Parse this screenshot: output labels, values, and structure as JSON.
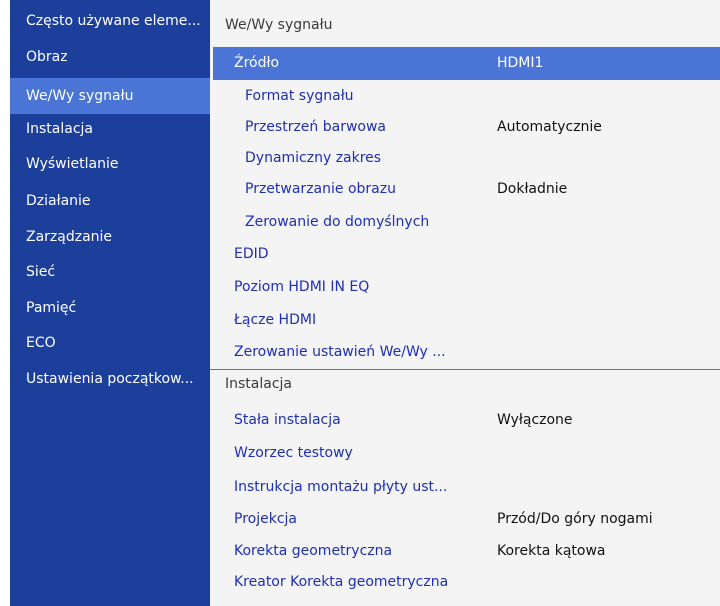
{
  "sidebar": {
    "items": [
      {
        "label": "Często używane eleme...",
        "active": false
      },
      {
        "label": "Obraz",
        "active": false
      },
      {
        "label": "We/Wy sygnału",
        "active": true
      },
      {
        "label": "Instalacja",
        "active": false
      },
      {
        "label": "Wyświetlanie",
        "active": false
      },
      {
        "label": "Działanie",
        "active": false
      },
      {
        "label": "Zarządzanie",
        "active": false
      },
      {
        "label": "Sieć",
        "active": false
      },
      {
        "label": "Pamięć",
        "active": false
      },
      {
        "label": "ECO",
        "active": false
      },
      {
        "label": "Ustawienia początkow...",
        "active": false
      }
    ]
  },
  "main": {
    "groups": [
      {
        "title": "We/Wy sygnału",
        "items": [
          {
            "label": "Źródło",
            "value": "HDMI1",
            "selected": true
          },
          {
            "label": "Format sygnału",
            "value": ""
          },
          {
            "label": "Przestrzeń barwowa",
            "value": "Automatycznie"
          },
          {
            "label": "Dynamiczny zakres",
            "value": ""
          },
          {
            "label": "Przetwarzanie obrazu",
            "value": "Dokładnie"
          },
          {
            "label": "Zerowanie do domyślnych",
            "value": ""
          },
          {
            "label": "EDID",
            "value": ""
          },
          {
            "label": "Poziom HDMI IN EQ",
            "value": ""
          },
          {
            "label": "Łącze HDMI",
            "value": ""
          },
          {
            "label": "Zerowanie ustawień We/Wy ...",
            "value": ""
          }
        ]
      },
      {
        "title": "Instalacja",
        "items": [
          {
            "label": "Stała instalacja",
            "value": "Wyłączone"
          },
          {
            "label": "Wzorzec testowy",
            "value": ""
          },
          {
            "label": "Instrukcja montażu płyty ust...",
            "value": ""
          },
          {
            "label": "Projekcja",
            "value": "Przód/Do góry nogami"
          },
          {
            "label": "Korekta geometryczna",
            "value": "Korekta kątowa"
          },
          {
            "label": "Kreator Korekta geometryczna",
            "value": ""
          }
        ]
      }
    ]
  },
  "colors": {
    "sidebar_bg": "#1d3f9c",
    "highlight": "#4a74d6",
    "main_bg": "#f4f4f4",
    "item_text": "#1d2fb3",
    "value_text": "#111111",
    "header_text": "#3b3b3b"
  }
}
